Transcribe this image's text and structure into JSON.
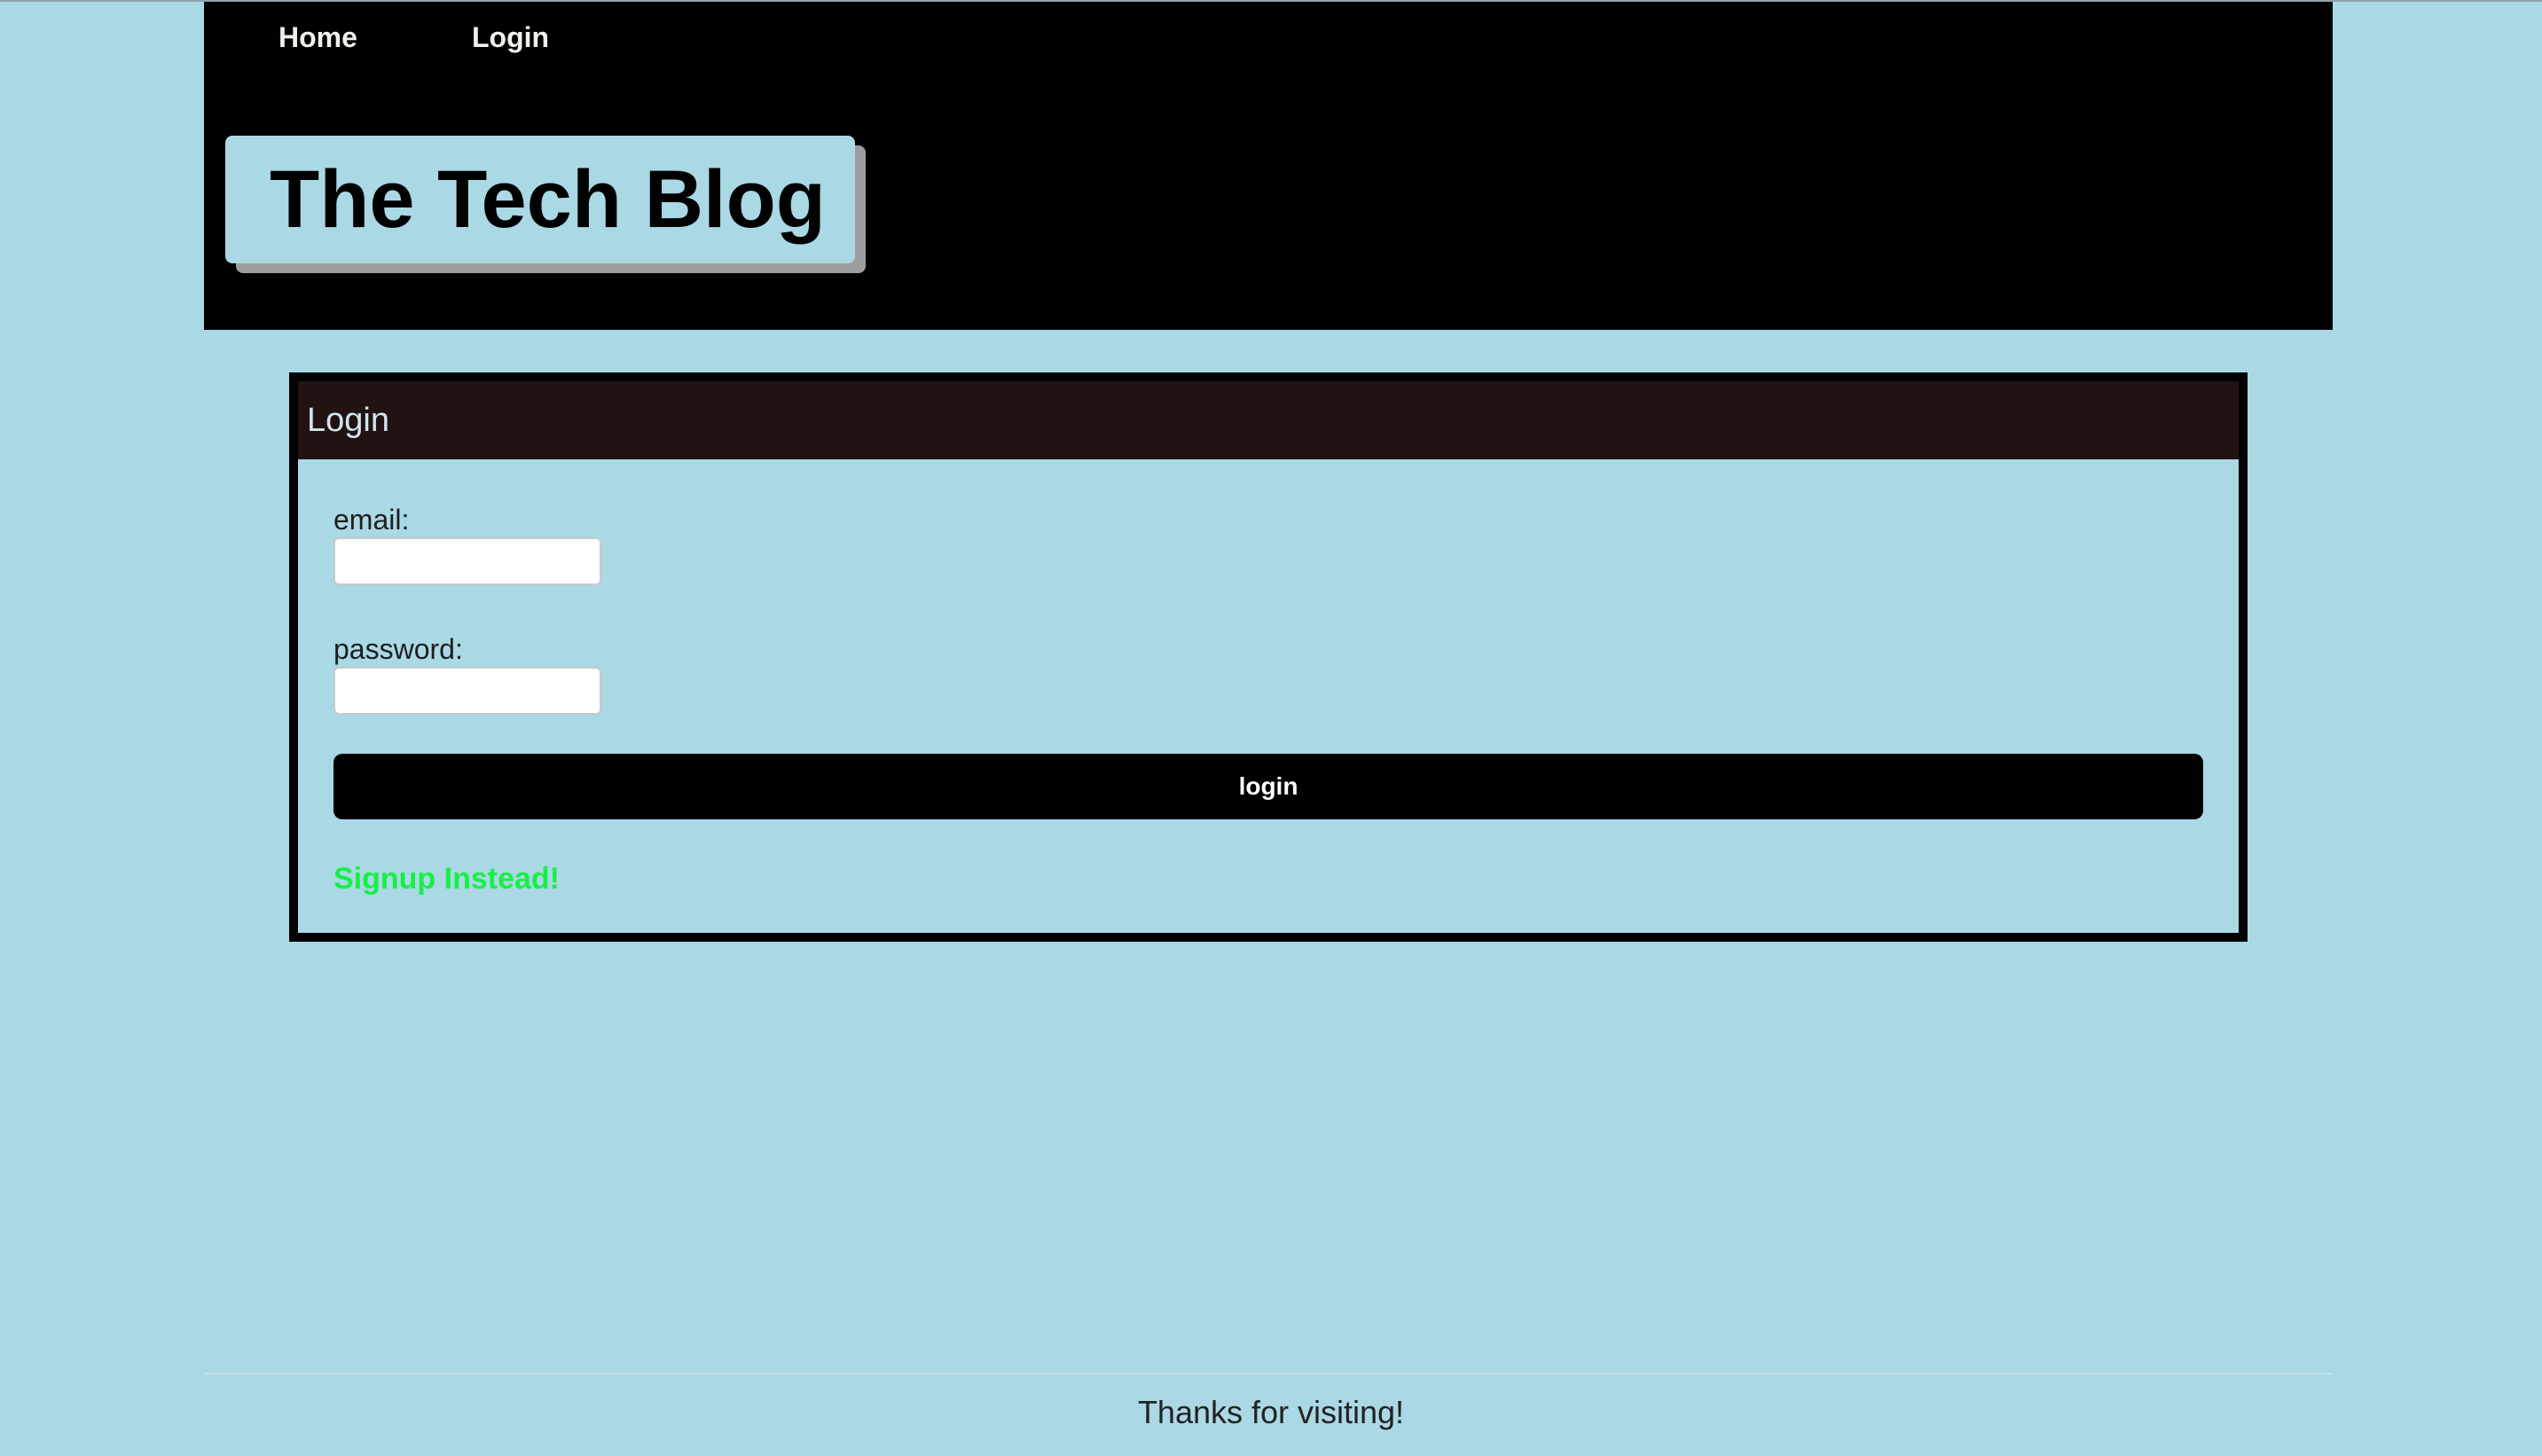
{
  "nav": {
    "items": [
      {
        "label": "Home"
      },
      {
        "label": "Login"
      }
    ]
  },
  "header": {
    "title": "The Tech Blog"
  },
  "login_card": {
    "title": "Login",
    "email_label": "email:",
    "email_value": "",
    "password_label": "password:",
    "password_value": "",
    "login_button_label": "login",
    "signup_link_label": "Signup Instead!"
  },
  "footer": {
    "text": "Thanks for visiting!"
  },
  "colors": {
    "page_background": "#aad8e5",
    "header_background": "#000000",
    "card_header_background": "#231212",
    "signup_link": "#16f045"
  }
}
